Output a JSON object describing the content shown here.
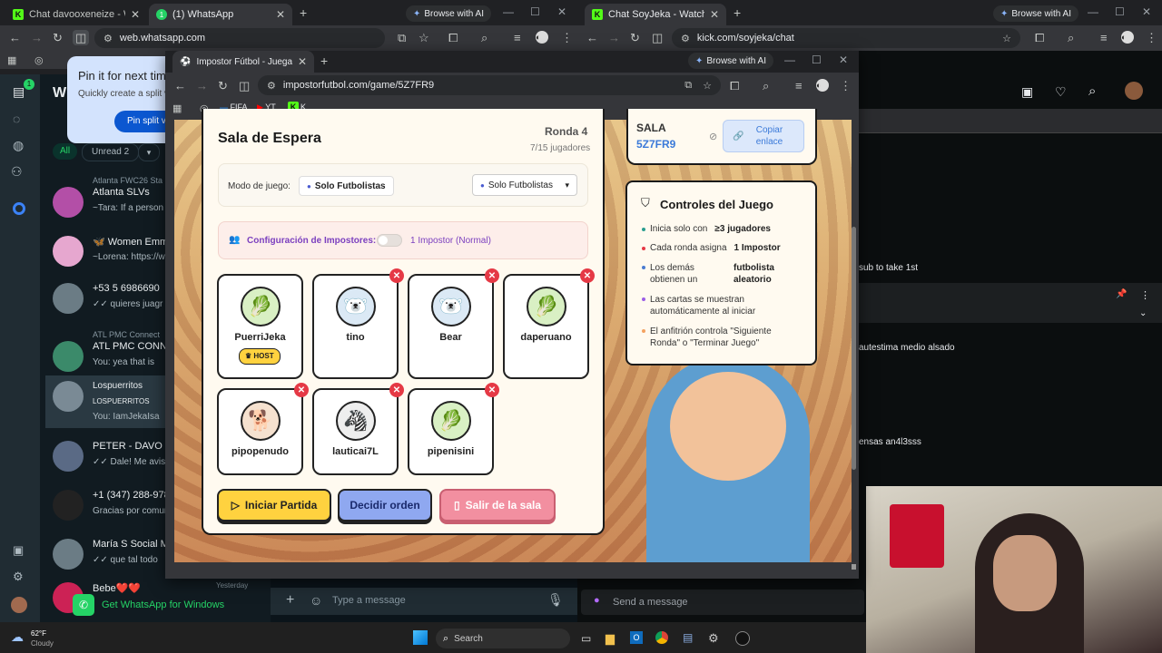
{
  "left_browser": {
    "tabs": [
      {
        "title": "Chat davooxeneize - Watch Live"
      },
      {
        "title": "(1) WhatsApp"
      }
    ],
    "browse_ai": "Browse with AI",
    "url": "web.whatsapp.com",
    "bookmark_k": "K"
  },
  "right_browser": {
    "tabs": [
      {
        "title": "Chat SoyJeka - Watch Live on K"
      }
    ],
    "browse_ai": "Browse with AI",
    "url": "kick.com/soyjeka/chat",
    "chat_lines": [
      "sub to take 1st",
      "autestima medio alsado",
      "ensas an4l3sss"
    ],
    "send_placeholder": "Send a message"
  },
  "whatsapp": {
    "title_fragment": "Wh",
    "popup": {
      "title": "Pin it for next tim",
      "body": "Quickly create a split vi",
      "button": "Pin split vie"
    },
    "filters": {
      "all": "All",
      "unread": "Unread 2"
    },
    "rail_badge": "1",
    "chats": [
      {
        "group": "Atlanta FWC26 Sta",
        "name": "Atlanta SLVs",
        "message": "~Tara: If a person i"
      },
      {
        "group": "",
        "name": "🦋 Women Emm",
        "message": "~Lorena: https://w"
      },
      {
        "group": "",
        "name": "+53 5 6986690",
        "message": "✓✓ quieres juagr"
      },
      {
        "group": "ATL PMC Connect",
        "name": "ATL PMC CONNE",
        "message": "You: yea that is"
      },
      {
        "group": "",
        "name": "Lospuerritos",
        "message": "You: IamJekaIsa"
      },
      {
        "group": "",
        "name": "PETER - DAVO FI",
        "message": "✓✓ Dale! Me avisas"
      },
      {
        "group": "",
        "name": "+1 (347) 288-978",
        "message": "Gracias por comuni"
      },
      {
        "group": "",
        "name": "María S Social M",
        "message": "✓✓ que tal todo"
      },
      {
        "group": "",
        "name": "Bebe❤️❤️",
        "message": ""
      }
    ],
    "lospuerritos_sub": "LOSPUERRITOS",
    "get_app": "Get WhatsApp for Windows",
    "message_placeholder": "Type a message",
    "yesterday": "Yesterday"
  },
  "popup_browser": {
    "tab_title": "Impostor Fútbol - Juega con ar",
    "browse_ai": "Browse with AI",
    "url": "impostorfutbol.com/game/5Z7FR9",
    "bookmarks": [
      "FIFA",
      "YT",
      "K"
    ]
  },
  "game": {
    "title": "Sala de Espera",
    "round": "Ronda 4",
    "players_count": "7/15 jugadores",
    "mode_label": "Modo de juego:",
    "mode_value": "Solo Futbolistas",
    "mode_select": "Solo Futbolistas",
    "impostor_config_label": "Configuración de Impostores:",
    "impostor_config_value": "1 Impostor (Normal)",
    "host_badge": "HOST",
    "players": [
      {
        "name": "PuerriJeka",
        "avatar": "leek"
      },
      {
        "name": "tino",
        "avatar": "polar-bear"
      },
      {
        "name": "Bear",
        "avatar": "polar-bear"
      },
      {
        "name": "daperuano",
        "avatar": "leek"
      },
      {
        "name": "pipopenudo",
        "avatar": "dog"
      },
      {
        "name": "lauticai7L",
        "avatar": "zebra"
      },
      {
        "name": "pipenisini",
        "avatar": "leek"
      }
    ],
    "buttons": {
      "start": "Iniciar Partida",
      "order": "Decidir orden",
      "leave": "Salir de la sala"
    },
    "room": {
      "label": "SALA",
      "code": "5Z7FR9",
      "copy": "Copiar enlace"
    },
    "controls": {
      "title": "Controles del Juego",
      "rules": [
        {
          "text": "Inicia solo con",
          "bold": "≥3 jugadores",
          "color": "#2a9d8f"
        },
        {
          "text": "Cada ronda asigna",
          "bold": "1 Impostor",
          "color": "#e63946"
        },
        {
          "text": "Los demás obtienen un",
          "bold": "futbolista aleatorio",
          "color": "#4a7bd0"
        },
        {
          "text": "Las cartas se muestran automáticamente al iniciar",
          "bold": "",
          "color": "#9b5de5"
        },
        {
          "text": "El anfitrión controla \"Siguiente Ronda\" o \"Terminar Juego\"",
          "bold": "",
          "color": "#f4a261"
        }
      ]
    }
  },
  "taskbar": {
    "weather_temp": "62°F",
    "weather_desc": "Cloudy",
    "search": "Search"
  }
}
